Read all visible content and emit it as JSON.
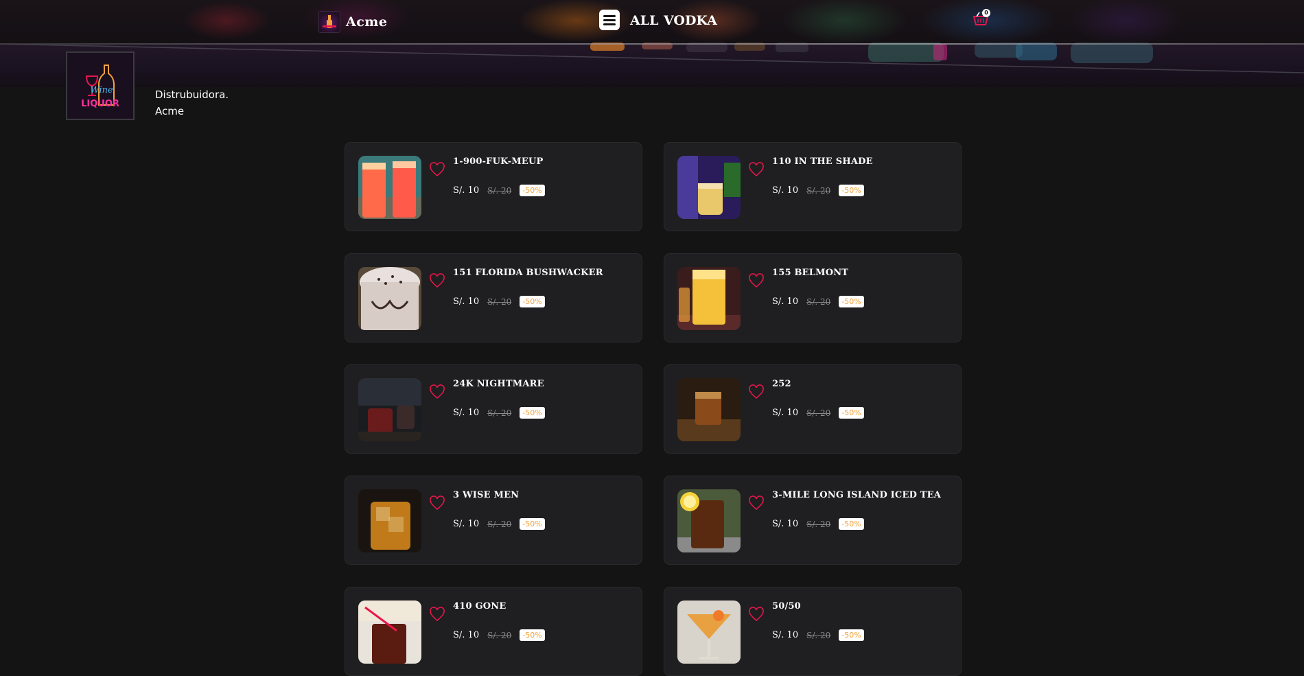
{
  "header": {
    "brand_name": "Acme",
    "nav": [
      "ALL",
      "VODKA"
    ],
    "cart_count": "0"
  },
  "company": {
    "logo_text_top": "Wine",
    "logo_text_bottom": "LIQUOR",
    "line1": "Distrubuidora.",
    "line2": "Acme"
  },
  "colors": {
    "background": "#151415",
    "card": "#1f1e20",
    "heart": "#e8164c",
    "discount_text": "#f5a23c"
  },
  "products": [
    {
      "name": "1-900-FUK-MEUP",
      "price": "S/. 10",
      "old_price": "S/. 20",
      "discount": "-50%",
      "thumb": "red-cocktail"
    },
    {
      "name": "110 IN THE SHADE",
      "price": "S/. 10",
      "old_price": "S/. 20",
      "discount": "-50%",
      "thumb": "yellow-cocktail"
    },
    {
      "name": "151 FLORIDA BUSHWACKER",
      "price": "S/. 10",
      "old_price": "S/. 20",
      "discount": "-50%",
      "thumb": "cream-drink"
    },
    {
      "name": "155 BELMONT",
      "price": "S/. 10",
      "old_price": "S/. 20",
      "discount": "-50%",
      "thumb": "orange-highball"
    },
    {
      "name": "24K NIGHTMARE",
      "price": "S/. 10",
      "old_price": "S/. 20",
      "discount": "-50%",
      "thumb": "dark-shot"
    },
    {
      "name": "252",
      "price": "S/. 10",
      "old_price": "S/. 20",
      "discount": "-50%",
      "thumb": "whiskey-shot"
    },
    {
      "name": "3 WISE MEN",
      "price": "S/. 10",
      "old_price": "S/. 20",
      "discount": "-50%",
      "thumb": "whiskey-rocks"
    },
    {
      "name": "3-MILE LONG ISLAND ICED TEA",
      "price": "S/. 10",
      "old_price": "S/. 20",
      "discount": "-50%",
      "thumb": "iced-tea"
    },
    {
      "name": "410 GONE",
      "price": "S/. 10",
      "old_price": "S/. 20",
      "discount": "-50%",
      "thumb": "cola-glass"
    },
    {
      "name": "50/50",
      "price": "S/. 10",
      "old_price": "S/. 20",
      "discount": "-50%",
      "thumb": "martini"
    }
  ]
}
